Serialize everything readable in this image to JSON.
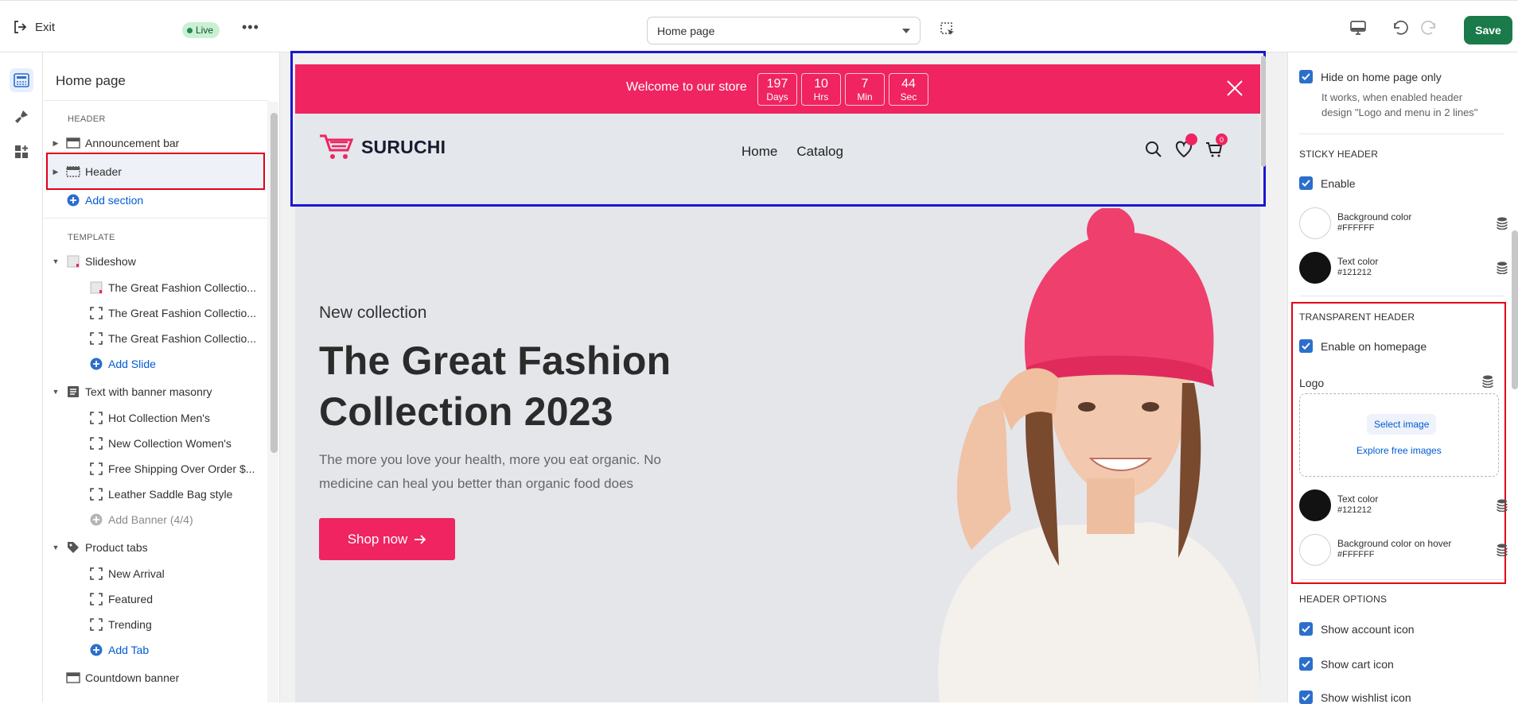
{
  "topbar": {
    "exit_label": "Exit",
    "status_badge": "Live",
    "more_label": "•••",
    "page_selector": "Home page",
    "save_label": "Save"
  },
  "sidebar": {
    "title": "Home page",
    "header_group_label": "HEADER",
    "template_group_label": "TEMPLATE",
    "header_items": [
      {
        "label": "Announcement bar"
      },
      {
        "label": "Header"
      }
    ],
    "add_section": "Add section",
    "template_items": {
      "slideshow": "Slideshow",
      "slides": [
        "The Great Fashion Collectio...",
        "The Great Fashion Collectio...",
        "The Great Fashion Collectio..."
      ],
      "add_slide": "Add Slide",
      "text_banner": "Text with banner masonry",
      "banners": [
        "Hot Collection Men's",
        "New Collection Women's",
        "Free Shipping Over Order $...",
        "Leather Saddle Bag style"
      ],
      "add_banner": "Add Banner (4/4)",
      "product_tabs": "Product tabs",
      "tabs": [
        "New Arrival",
        "Featured",
        "Trending"
      ],
      "add_tab": "Add Tab",
      "countdown": "Countdown banner"
    }
  },
  "preview": {
    "announcement": {
      "text": "Welcome to our store",
      "countdown": [
        {
          "value": "197",
          "unit": "Days"
        },
        {
          "value": "10",
          "unit": "Hrs"
        },
        {
          "value": "7",
          "unit": "Min"
        },
        {
          "value": "44",
          "unit": "Sec"
        }
      ]
    },
    "header": {
      "logo": "SURUCHI",
      "nav": [
        "Home",
        "Catalog"
      ],
      "cart_count": "0"
    },
    "hero": {
      "subtitle": "New collection",
      "title": "The Great Fashion Collection 2023",
      "description": "The more you love your health, more you eat organic. No medicine can heal you better than organic food does",
      "button": "Shop now"
    },
    "accent_color": "#ef2461"
  },
  "settings": {
    "hide_on_home": "Hide on home page only",
    "hide_note": "It works, when enabled header design \"Logo and menu in 2 lines\"",
    "sticky_header": "STICKY HEADER",
    "sticky_enable": "Enable",
    "sticky_bg_name": "Background color",
    "sticky_bg_value": "#FFFFFF",
    "sticky_text_name": "Text color",
    "sticky_text_value": "#121212",
    "transparent_header": "TRANSPARENT HEADER",
    "enable_homepage": "Enable on homepage",
    "logo_label": "Logo",
    "select_image": "Select image",
    "explore_images": "Explore free images",
    "trans_text_name": "Text color",
    "trans_text_value": "#121212",
    "trans_hover_name": "Background color on hover",
    "trans_hover_value": "#FFFFFF",
    "header_options": "HEADER OPTIONS",
    "show_account": "Show account icon",
    "show_cart": "Show cart icon",
    "show_wishlist": "Show wishlist icon"
  }
}
